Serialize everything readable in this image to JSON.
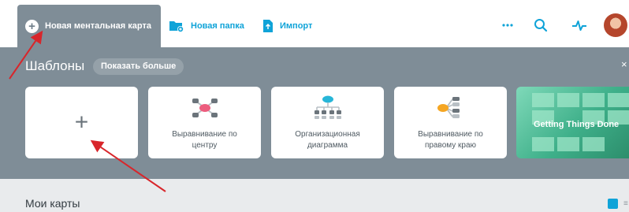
{
  "toolbar": {
    "new_map_label": "Новая ментальная карта",
    "new_folder_label": "Новая папка",
    "import_label": "Импорт",
    "more_icon": "more-dots-icon",
    "search_icon": "search-icon",
    "activity_icon": "activity-pulse-icon",
    "avatar_icon": "user-avatar"
  },
  "templates": {
    "title": "Шаблоны",
    "show_more_label": "Показать больше",
    "close_glyph": "×",
    "cards": [
      {
        "label_line1": "",
        "label_line2": "",
        "icon": "plus-icon"
      },
      {
        "label_line1": "Выравнивание по",
        "label_line2": "центру",
        "icon": "center-align-map-icon"
      },
      {
        "label_line1": "Организационная",
        "label_line2": "диаграмма",
        "icon": "org-chart-icon"
      },
      {
        "label_line1": "Выравнивание по",
        "label_line2": "правому краю",
        "icon": "right-align-map-icon"
      },
      {
        "label_line1": "Getting Things Done",
        "label_line2": "",
        "icon": "gtd-sticky-notes-image"
      }
    ]
  },
  "my_maps": {
    "title": "Мои карты",
    "grid_view_icon": "grid-view-icon",
    "list_view_icon": "list-view-icon"
  },
  "colors": {
    "accent": "#0fa3d8",
    "templates_bg": "#7f8d97",
    "annotation_arrow": "#d8262b"
  }
}
